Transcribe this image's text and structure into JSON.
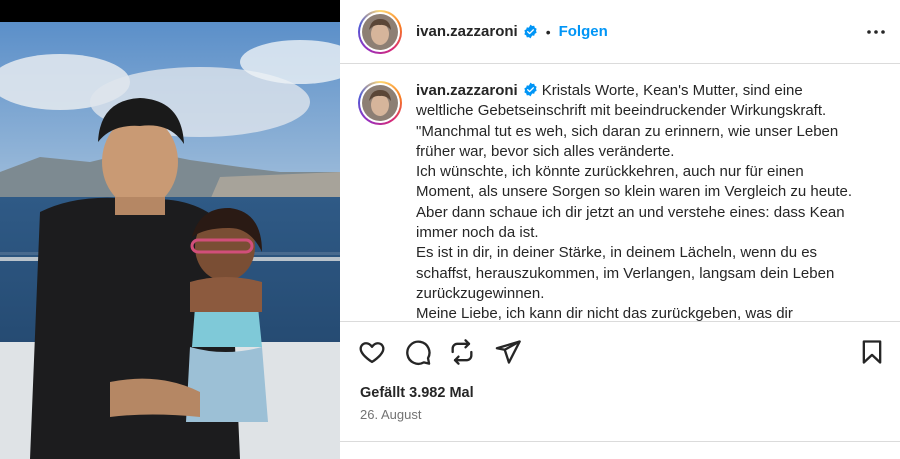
{
  "post": {
    "username": "ivan.zazzaroni",
    "separator": "•",
    "follow_label": "Folgen",
    "caption_lines": [
      "Kristals Worte, Kean's Mutter, sind eine",
      "weltliche Gebetseinschrift mit beeindruckender Wirkungskraft.",
      "\"Manchmal tut es weh, sich daran zu erinnern, wie unser Leben",
      "früher war, bevor sich alles veränderte.",
      "Ich wünschte, ich könnte zurückkehren, auch nur für einen",
      "Moment, als unsere Sorgen so klein waren im Vergleich zu heute.",
      "Aber dann schaue ich dir jetzt an und verstehe eines: dass Kean",
      "immer noch da ist.",
      "Es ist in dir, in deiner Stärke, in deinem Lächeln, wenn du es",
      "schaffst, herauszukommen, im Verlangen, langsam dein Leben",
      "zurückzugewinnen.",
      "Meine Liebe, ich kann dir nicht das zurückgeben, was dir"
    ],
    "likes": "Gefällt 3.982 Mal",
    "date": "26. August"
  },
  "icons": {
    "verified": "verified-badge-icon",
    "more": "more-options-icon",
    "like": "heart-icon",
    "comment": "comment-icon",
    "share": "repost-icon",
    "send": "send-icon",
    "save": "bookmark-icon"
  },
  "colors": {
    "link_blue": "#0095f6",
    "verified_blue": "#0095f6",
    "text": "#262626",
    "muted": "#737373",
    "divider": "#dbdbdb"
  }
}
